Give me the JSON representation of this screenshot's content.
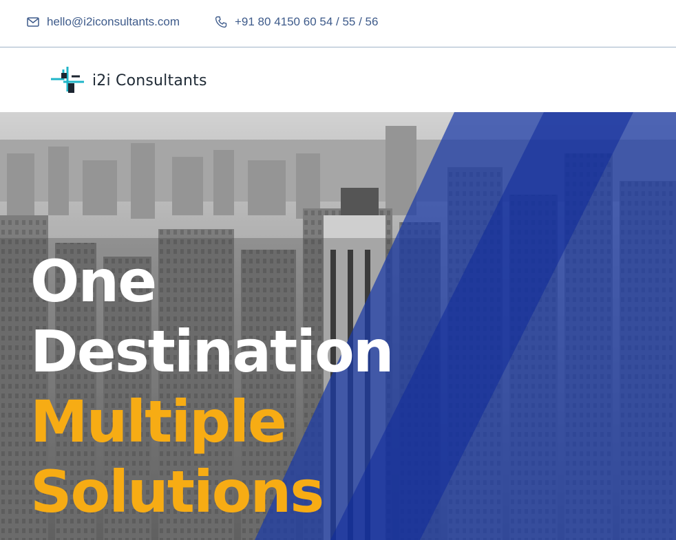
{
  "topbar": {
    "email": "hello@i2iconsultants.com",
    "phone": "+91 80 4150 60 54 / 55 / 56",
    "email_icon": "envelope-icon",
    "phone_icon": "phone-icon"
  },
  "header": {
    "logo_text": "i2i Consultants",
    "logo_icon": "i2i-logo-mark"
  },
  "hero": {
    "line1": "One",
    "line2": "Destination",
    "line3": "Multiple",
    "line4": "Solutions"
  },
  "colors": {
    "accent_blue": "#1a3aa8",
    "accent_yellow": "#f7ac14",
    "link": "#3d5a8a"
  }
}
